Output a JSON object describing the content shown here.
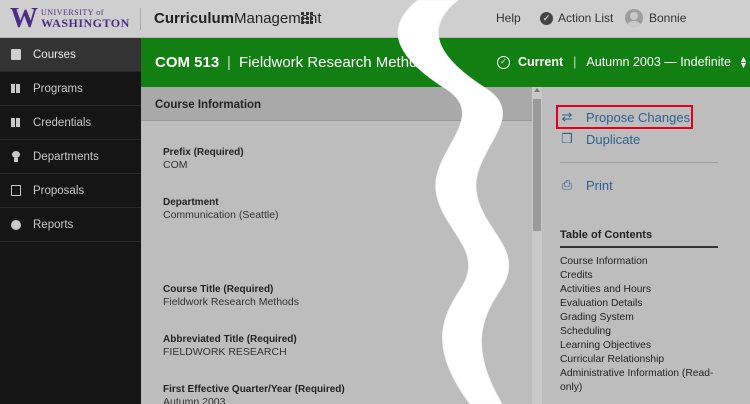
{
  "header": {
    "logo_w": "W",
    "logo_university": "UNIVERSITY of",
    "logo_washington": "WASHINGTON",
    "app_title_bold": "Curriculum",
    "app_title_rest": "Management",
    "help": "Help",
    "action_list": "Action List",
    "user": "Bonnie"
  },
  "sidebar": {
    "items": [
      {
        "label": "Courses",
        "icon": "courses-icon"
      },
      {
        "label": "Programs",
        "icon": "programs-icon"
      },
      {
        "label": "Credentials",
        "icon": "credentials-icon"
      },
      {
        "label": "Departments",
        "icon": "departments-icon"
      },
      {
        "label": "Proposals",
        "icon": "proposals-icon"
      },
      {
        "label": "Reports",
        "icon": "reports-icon"
      }
    ]
  },
  "course": {
    "code": "COM 513",
    "separator": "|",
    "name": "Fieldwork Research Methods",
    "status": "Current",
    "term": "Autumn 2003 — Indefinite"
  },
  "main": {
    "section_title": "Course Information",
    "fields": [
      {
        "label": "Prefix (Required)",
        "value": "COM"
      },
      {
        "label": "Department",
        "value": "Communication (Seattle)"
      },
      {
        "label": "Course Title (Required)",
        "value": "Fieldwork Research Methods"
      },
      {
        "label": "Abbreviated Title (Required)",
        "value": "FIELDWORK RESEARCH"
      },
      {
        "label": "First Effective Quarter/Year (Required)",
        "value": "Autumn 2003"
      }
    ]
  },
  "right_panel": {
    "propose_changes": "Propose Changes",
    "duplicate": "Duplicate",
    "print": "Print",
    "toc_title": "Table of Contents",
    "toc_items": [
      "Course Information",
      "Credits",
      "Activities and Hours",
      "Evaluation Details",
      "Grading System",
      "Scheduling",
      "Learning Objectives",
      "Curricular Relationship",
      "Administrative Information (Read-only)"
    ]
  },
  "colors": {
    "brand_purple": "#4b2e83",
    "course_band_green": "#117f12",
    "link_blue": "#2e5f93",
    "highlight_red": "#e3001b"
  }
}
